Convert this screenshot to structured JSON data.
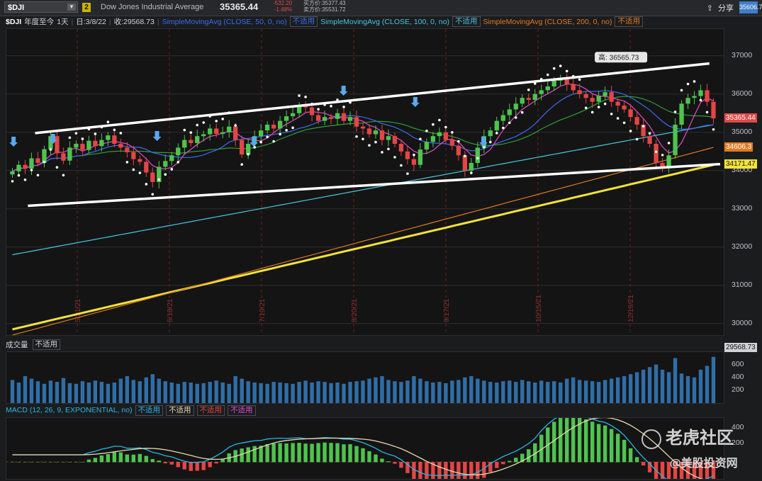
{
  "topbar": {
    "symbol": "$DJI",
    "badge": "2",
    "name": "Dow Jones Industrial Average",
    "price": "35365.44",
    "change": "-532.20",
    "change_pct": "-1.48%",
    "bid": "买方价:35377.43",
    "ask": "卖方价:35531.72",
    "share_label": "分享",
    "right_price": "35606.7"
  },
  "study_bar": {
    "symbol": "$DJI",
    "period": "年度至今",
    "interval": "1天",
    "date": "日:3/8/22",
    "last": "收:29568.73",
    "sma50": "SimpleMovingAvg (CLOSE, 50, 0, no)",
    "sma100": "SimpleMovingAvg (CLOSE, 100, 0, no)",
    "sma200": "SimpleMovingAvg (CLOSE, 200, 0, no)",
    "na": "不适用"
  },
  "volume_bar": {
    "title": "成交量",
    "na": "不适用"
  },
  "macd_bar": {
    "title": "MACD (12, 26, 9, EXPONENTIAL, no)",
    "na": "不适用"
  },
  "colors": {
    "sma50": "#3b6cf0",
    "sma100": "#47c6e0",
    "sma200": "#e07a24",
    "line5": "#e24ccd",
    "line20": "#2f9e3a",
    "line_yellow": "#f2e33a",
    "up": "#4ec44e",
    "down": "#e44545",
    "channel": "#ffffff",
    "volume": "#2f6ea8",
    "macd": "#27b7e5",
    "signal": "#e8d9b0"
  },
  "watermark": {
    "line1": "老虎社区",
    "line2": "@美股投资网"
  },
  "chart_data": {
    "type": "candlestick",
    "y_axis_ticks": [
      30000,
      31000,
      32000,
      33000,
      34000,
      35000,
      36000,
      37000
    ],
    "ylim": [
      29700,
      37700
    ],
    "date_labels": [
      "5/21/21",
      "6/18/21",
      "7/19/21",
      "8/20/21",
      "9/17/21",
      "10/15/21",
      "12/19/21"
    ],
    "price_labels": [
      {
        "label": "35365.44",
        "value": 35365.44,
        "color": "#e04848"
      },
      {
        "label": "34606.3",
        "value": 34606.3,
        "color": "#e07a24"
      },
      {
        "label": "34171.47",
        "value": 34171.47,
        "color": "#f2e33a"
      },
      {
        "label": "29568.73",
        "value": 29568.73,
        "color": "#cfd2d6"
      }
    ],
    "high_annotation": "高: 36565.73",
    "high_value": 36565.73,
    "channel_upper": [
      [
        0.04,
        34980
      ],
      [
        0.98,
        36800
      ]
    ],
    "channel_lower": [
      [
        0.03,
        33080
      ],
      [
        0.995,
        34170
      ]
    ],
    "closes": [
      33980,
      34150,
      34050,
      34320,
      34200,
      34560,
      34900,
      34450,
      34260,
      34600,
      34700,
      34540,
      34780,
      34640,
      34800,
      34920,
      34700,
      34600,
      34480,
      34300,
      34230,
      33950,
      33700,
      34100,
      34250,
      34400,
      34600,
      34800,
      34720,
      34900,
      34950,
      35100,
      34960,
      35000,
      35150,
      34800,
      34420,
      34700,
      34900,
      35050,
      35200,
      35100,
      35300,
      35420,
      35500,
      35700,
      35650,
      35450,
      35300,
      35400,
      35350,
      35500,
      35300,
      35400,
      35150,
      35100,
      34950,
      35050,
      34800,
      34900,
      34700,
      34500,
      34300,
      34150,
      34550,
      34750,
      34900,
      35000,
      34800,
      34650,
      34400,
      34000,
      34200,
      34600,
      34900,
      35050,
      35300,
      35450,
      35600,
      35750,
      35900,
      35850,
      36000,
      36100,
      36200,
      36350,
      36400,
      36250,
      36100,
      36000,
      35900,
      35800,
      35950,
      36050,
      35800,
      35700,
      35600,
      35400,
      35200,
      34900,
      34700,
      34200,
      34100,
      34400,
      35200,
      35750,
      35900,
      35950,
      36100,
      35800,
      35365
    ],
    "volume_ticks": [
      200,
      400,
      600
    ],
    "volume": [
      360,
      320,
      420,
      380,
      340,
      300,
      350,
      330,
      390,
      310,
      300,
      340,
      320,
      350,
      330,
      300,
      320,
      380,
      420,
      360,
      340,
      400,
      450,
      380,
      340,
      320,
      300,
      330,
      320,
      300,
      310,
      330,
      350,
      320,
      300,
      420,
      380,
      340,
      320,
      310,
      300,
      330,
      320,
      310,
      300,
      330,
      350,
      320,
      340,
      330,
      310,
      320,
      300,
      330,
      340,
      350,
      380,
      400,
      420,
      360,
      340,
      330,
      350,
      420,
      380,
      340,
      320,
      330,
      310,
      350,
      360,
      400,
      420,
      380,
      350,
      330,
      320,
      340,
      350,
      330,
      360,
      340,
      320,
      350,
      330,
      340,
      320,
      380,
      400,
      360,
      350,
      340,
      330,
      360,
      380,
      400,
      420,
      450,
      480,
      520,
      560,
      600,
      520,
      480,
      700,
      460,
      420,
      400,
      520,
      580,
      720
    ],
    "macd_ticks": [
      200,
      400
    ]
  }
}
